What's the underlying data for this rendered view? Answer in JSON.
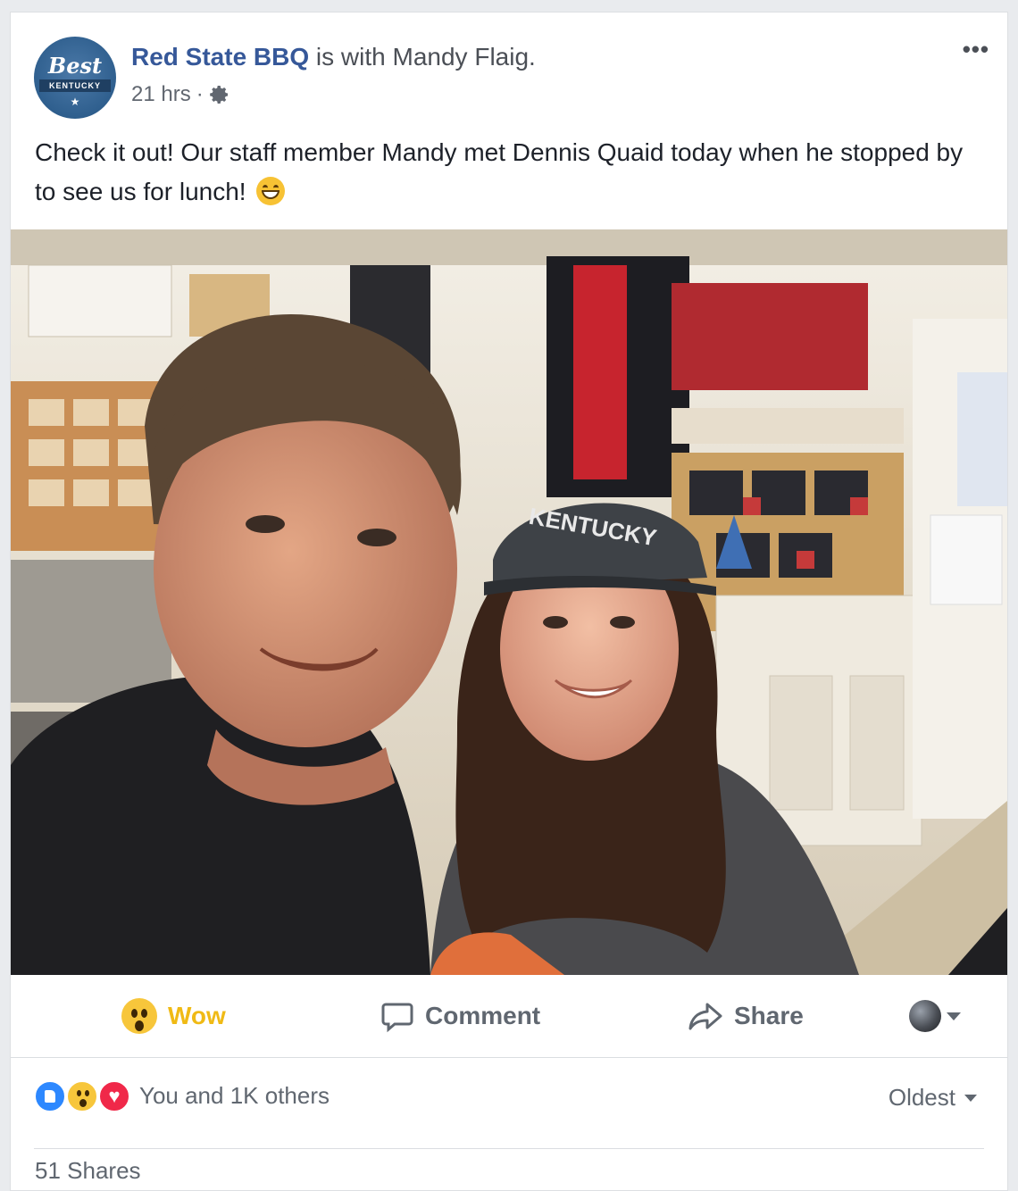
{
  "post": {
    "page_name": "Red State BBQ",
    "with_text": " is with ",
    "tagged_person": "Mandy Flaig.",
    "time": "21 hrs",
    "separator": "·",
    "text": "Check it out! Our staff member Mandy met Dennis Quaid today when he stopped by to see us for lunch!",
    "more_options": "•••"
  },
  "avatar": {
    "label": "Best",
    "banner": "KENTUCKY",
    "star": "★"
  },
  "photo_sign": {
    "cap_text": "KENTUCKY"
  },
  "actions": {
    "wow": "Wow",
    "comment": "Comment",
    "share": "Share"
  },
  "reactions": {
    "summary": "You and 1K others",
    "sort": "Oldest"
  },
  "shares": "51 Shares",
  "colors": {
    "link_blue": "#365899",
    "wow_yellow": "#f0ba15",
    "text_gray": "#606770",
    "like_blue": "#2d88ff",
    "love_red": "#f02849"
  },
  "icons": {
    "settings": "gear-icon",
    "comment": "comment-icon",
    "share": "share-arrow-icon",
    "audience": "globe-icon"
  }
}
